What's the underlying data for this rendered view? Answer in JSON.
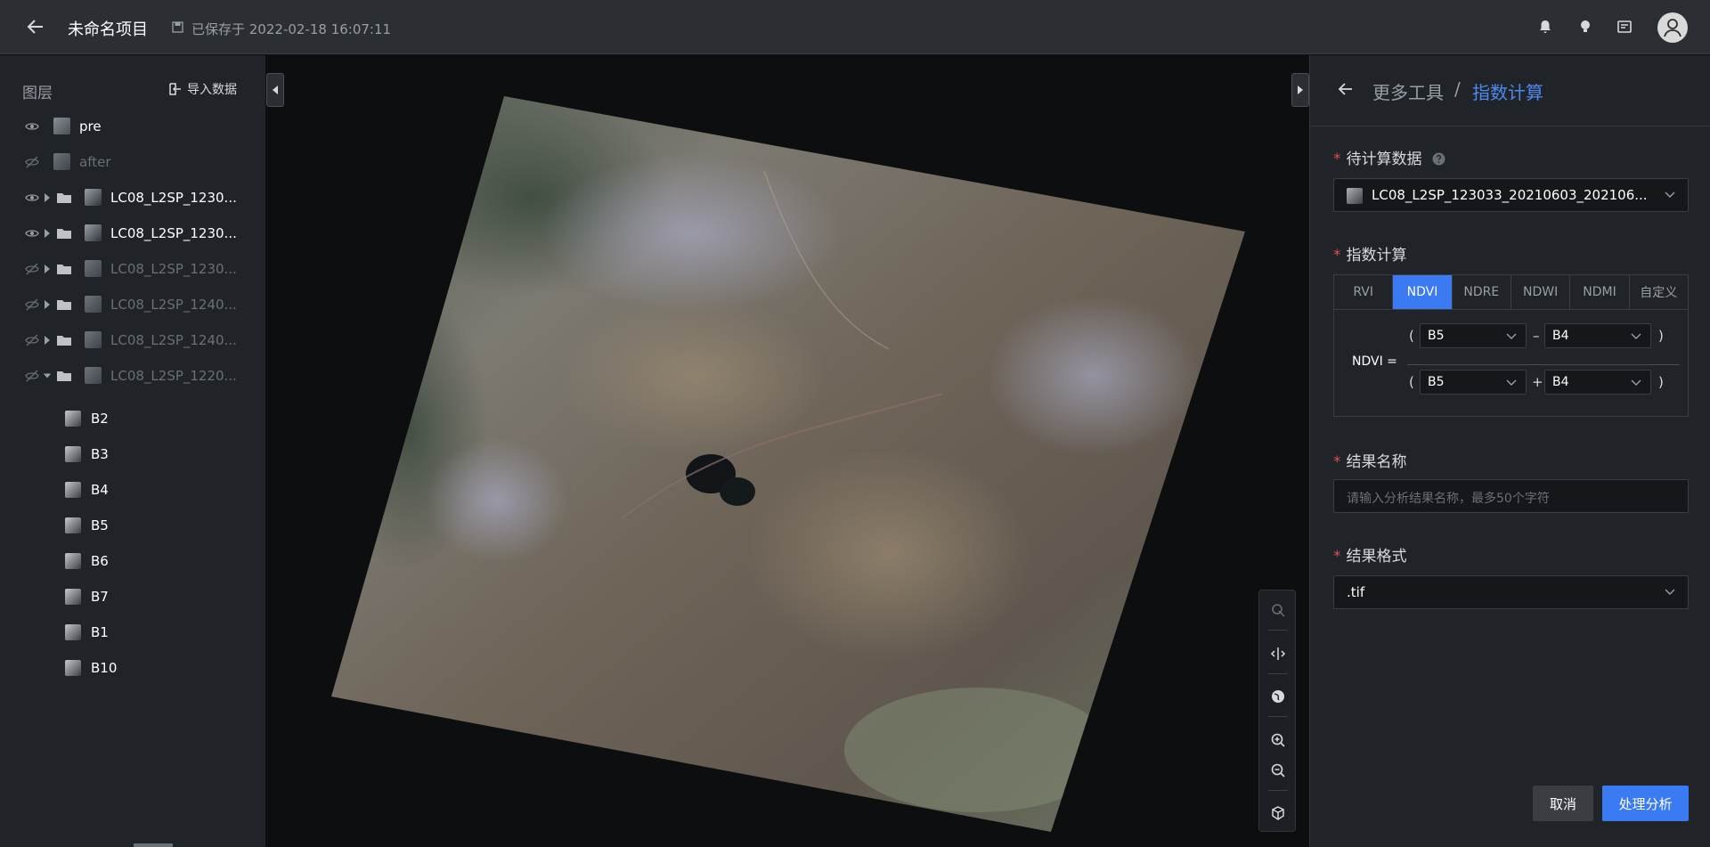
{
  "topbar": {
    "project_name": "未命名项目",
    "saved_text": "已保存于 2022-02-18 16:07:11"
  },
  "layers_panel": {
    "title": "图层",
    "import_label": "导入数据",
    "layers": [
      {
        "name": "pre",
        "visible": true
      },
      {
        "name": "after",
        "visible": false
      },
      {
        "name": "LC08_L2SP_1230...",
        "visible": true
      },
      {
        "name": "LC08_L2SP_1230...",
        "visible": true
      },
      {
        "name": "LC08_L2SP_1230...",
        "visible": false
      },
      {
        "name": "LC08_L2SP_1240...",
        "visible": false
      },
      {
        "name": "LC08_L2SP_1240...",
        "visible": false
      },
      {
        "name": "LC08_L2SP_1220...",
        "visible": false,
        "expanded": true
      }
    ],
    "bands": [
      "B2",
      "B3",
      "B4",
      "B5",
      "B6",
      "B7",
      "B1",
      "B10"
    ]
  },
  "tool_panel": {
    "breadcrumb_parent": "更多工具",
    "breadcrumb_sep": "/",
    "breadcrumb_current": "指数计算",
    "data_label": "待计算数据",
    "data_value": "LC08_L2SP_123033_20210603_202106...",
    "index_label": "指数计算",
    "tabs": [
      "RVI",
      "NDVI",
      "NDRE",
      "NDWI",
      "NDMI",
      "自定义"
    ],
    "active_tab": "NDVI",
    "formula": {
      "lhs": "NDVI =",
      "open": "(",
      "close": ")",
      "minus": "–",
      "plus": "+",
      "num_a": "B5",
      "num_b": "B4",
      "den_a": "B5",
      "den_b": "B4"
    },
    "result_name_label": "结果名称",
    "result_name_placeholder": "请输入分析结果名称，最多50个字符",
    "result_format_label": "结果格式",
    "result_format_value": ".tif",
    "cancel_label": "取消",
    "run_label": "处理分析"
  },
  "colors": {
    "accent": "#3a7af2",
    "breadcrumb_active": "#4d8af0",
    "required": "#e5484d"
  }
}
